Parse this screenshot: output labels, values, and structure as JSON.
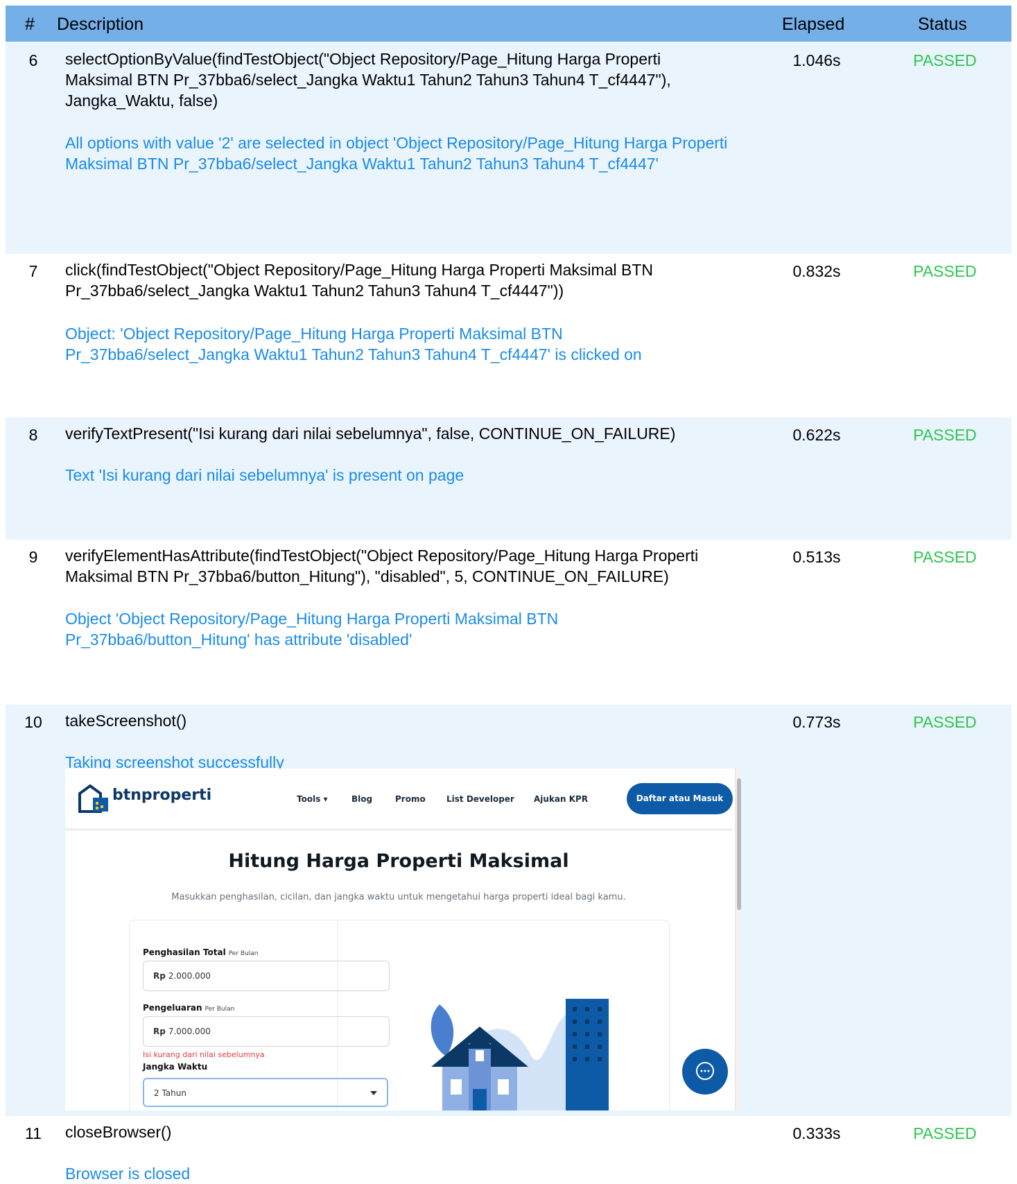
{
  "header": {
    "num": "#",
    "description": "Description",
    "elapsed": "Elapsed",
    "status": "Status"
  },
  "rows": [
    {
      "num": "6",
      "command": "selectOptionByValue(findTestObject(\"Object Repository/Page_Hitung Harga Properti Maksimal  BTN Pr_37bba6/select_Jangka Waktu1 Tahun2 Tahun3 Tahun4 T_cf4447\"), Jangka_Waktu, false)",
      "message": "All options with value '2' are selected in object 'Object Repository/Page_Hitung Harga Properti Maksimal  BTN Pr_37bba6/select_Jangka Waktu1 Tahun2 Tahun3 Tahun4 T_cf4447'",
      "elapsed": "1.046s",
      "status": "PASSED"
    },
    {
      "num": "7",
      "command": "click(findTestObject(\"Object Repository/Page_Hitung Harga Properti Maksimal  BTN Pr_37bba6/select_Jangka Waktu1 Tahun2 Tahun3 Tahun4 T_cf4447\"))",
      "message": "Object: 'Object Repository/Page_Hitung Harga Properti Maksimal  BTN Pr_37bba6/select_Jangka Waktu1 Tahun2 Tahun3 Tahun4 T_cf4447' is clicked on",
      "elapsed": "0.832s",
      "status": "PASSED"
    },
    {
      "num": "8",
      "command": "verifyTextPresent(\"Isi kurang dari nilai sebelumnya\", false, CONTINUE_ON_FAILURE)",
      "message": "Text 'Isi kurang dari nilai sebelumnya' is present on page",
      "elapsed": "0.622s",
      "status": "PASSED"
    },
    {
      "num": "9",
      "command": "verifyElementHasAttribute(findTestObject(\"Object Repository/Page_Hitung Harga Properti Maksimal  BTN Pr_37bba6/button_Hitung\"), \"disabled\", 5, CONTINUE_ON_FAILURE)",
      "message": "Object 'Object Repository/Page_Hitung Harga Properti Maksimal  BTN Pr_37bba6/button_Hitung' has attribute 'disabled'",
      "elapsed": "0.513s",
      "status": "PASSED"
    },
    {
      "num": "10",
      "command": "takeScreenshot()",
      "message": "Taking screenshot successfully",
      "elapsed": "0.773s",
      "status": "PASSED"
    },
    {
      "num": "11",
      "command": "closeBrowser()",
      "message": "Browser is closed",
      "elapsed": "0.333s",
      "status": "PASSED"
    }
  ],
  "screenshot": {
    "logo": "btnproperti",
    "nav": [
      "Tools ▾",
      "Blog",
      "Promo",
      "List Developer",
      "Ajukan KPR"
    ],
    "cta": "Daftar atau Masuk",
    "title": "Hitung Harga Properti Maksimal",
    "subtitle": "Masukkan penghasilan, cicilan, dan jangka waktu untuk mengetahui harga properti ideal bagi kamu.",
    "income_label": "Penghasilan Total",
    "income_sub": "Per Bulan",
    "income_prefix": "Rp",
    "income_value": "2.000.000",
    "expense_label": "Pengeluaran",
    "expense_sub": "Per Bulan",
    "expense_prefix": "Rp",
    "expense_value": "7.000.000",
    "error_text": "Isi kurang dari nilai sebelumnya",
    "term_label": "Jangka Waktu",
    "term_value": "2 Tahun"
  },
  "colors": {
    "header": "#74afe8",
    "row_shade": "#eaf4fd",
    "message": "#1a8be8",
    "passed": "#2cc64e",
    "brand": "#0d5aa7"
  }
}
